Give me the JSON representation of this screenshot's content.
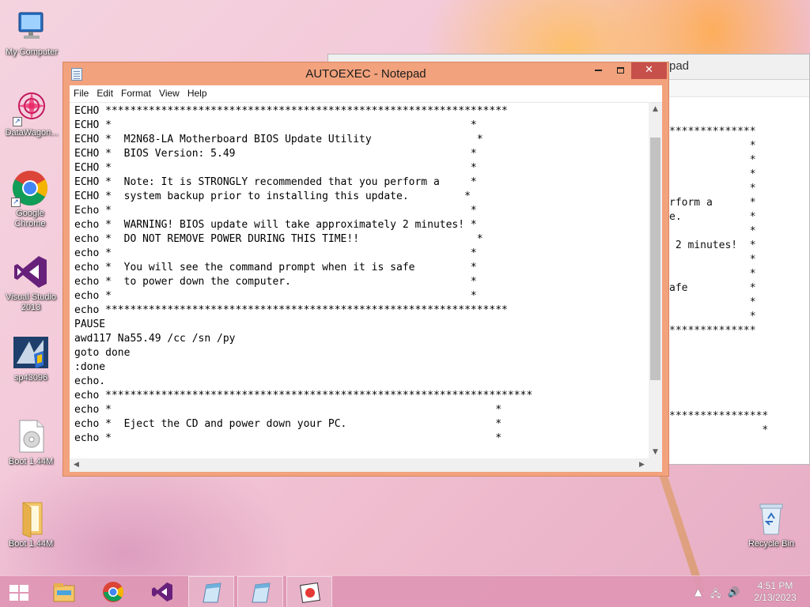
{
  "desktop": {
    "icons": [
      {
        "label": "My Computer",
        "icon": "computer-icon"
      },
      {
        "label": "DataWagon...",
        "icon": "datawagon-icon"
      },
      {
        "label": "Google Chrome",
        "icon": "chrome-icon"
      },
      {
        "label": "Visual Studio 2013",
        "icon": "visual-studio-icon"
      },
      {
        "label": "sp43096",
        "icon": "installer-icon"
      },
      {
        "label": "Boot 1.44M",
        "icon": "disk-image-icon"
      },
      {
        "label": "Boot 1.44M",
        "icon": "folder-icon"
      },
      {
        "label": "Recycle Bin",
        "icon": "recycle-bin-icon"
      }
    ]
  },
  "background_window": {
    "title_fragment": "pad",
    "text": "**************\n             *\n             *\n             *\n             *\nrform a      *\ne.           *\n             *\n 2 minutes!  *\n             *\n             *\nafe          *\n             *\n             *\n**************\n\n\n\n\n\n****************\n               *"
  },
  "notepad": {
    "title": "AUTOEXEC - Notepad",
    "menu": [
      "File",
      "Edit",
      "Format",
      "View",
      "Help"
    ],
    "content": "ECHO *****************************************************************\nECHO *                                                          *\nECHO *  M2N68-LA Motherboard BIOS Update Utility                 *\nECHO *  BIOS Version: 5.49                                      *\nECHO *                                                          *\nECHO *  Note: It is STRONGLY recommended that you perform a     *\nECHO *  system backup prior to installing this update.         *\nEcho *                                                          *\necho *  WARNING! BIOS update will take approximately 2 minutes! *\necho *  DO NOT REMOVE POWER DURING THIS TIME!!                   *\necho *                                                          *\necho *  You will see the command prompt when it is safe         *\necho *  to power down the computer.                             *\necho *                                                          *\necho *****************************************************************\nPAUSE\nawd117 Na55.49 /cc /sn /py\ngoto done\n:done\necho.\necho *********************************************************************\necho *                                                              *\necho *  Eject the CD and power down your PC.                        *\necho *                                                              *"
  },
  "taskbar": {
    "apps": [
      {
        "name": "file-explorer",
        "icon": "folder-icon"
      },
      {
        "name": "chrome",
        "icon": "chrome-icon"
      },
      {
        "name": "visual-studio",
        "icon": "visual-studio-icon"
      },
      {
        "name": "notepad-1",
        "icon": "notepad-icon"
      },
      {
        "name": "notepad-2",
        "icon": "notepad-icon"
      },
      {
        "name": "paint",
        "icon": "paint-icon"
      }
    ],
    "time": "4:51 PM",
    "date": "2/13/2023"
  },
  "colors": {
    "window_frame": "#f2a27c",
    "close_button": "#c7504a",
    "taskbar": "#de96b4"
  }
}
